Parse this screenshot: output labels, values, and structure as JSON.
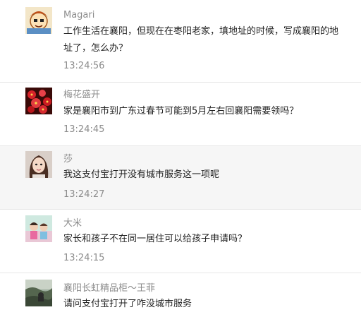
{
  "messages": [
    {
      "name": "Magari",
      "text": "工作生活在襄阳，但现在在枣阳老家，填地址的时候，写成襄阳的地址了，怎么办？",
      "time": "13:24:56",
      "avatar": "cartoon-avatar"
    },
    {
      "name": "梅花盛开",
      "text": "家是襄阳市到广东过春节可能到5月左右回襄阳需要领吗？",
      "time": "13:24:45",
      "avatar": "flower-avatar"
    },
    {
      "name": "莎",
      "text": "我这支付宝打开没有城市服务这一项呢",
      "time": "13:24:27",
      "avatar": "portrait-avatar"
    },
    {
      "name": "大米",
      "text": "家长和孩子不在同一居住可以给孩子申请吗？",
      "time": "13:24:15",
      "avatar": "kids-avatar"
    },
    {
      "name": "襄阳长虹精品柜～王菲",
      "text": "请问支付宝打开了咋没城市服务",
      "time": "",
      "avatar": "landscape-avatar"
    }
  ]
}
